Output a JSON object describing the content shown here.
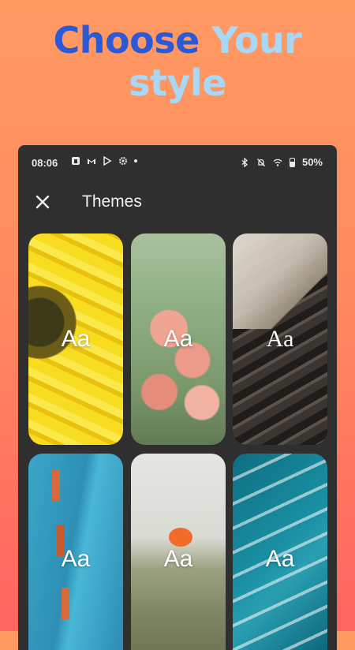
{
  "headline": {
    "word1": "Choose",
    "word2": "Your",
    "line2": "style"
  },
  "status_bar": {
    "time": "08:06",
    "battery": "50%"
  },
  "app_bar": {
    "title": "Themes"
  },
  "themes": [
    {
      "label": "Aa"
    },
    {
      "label": "Aa"
    },
    {
      "label": "Aa"
    },
    {
      "label": "Aa"
    },
    {
      "label": "Aa"
    },
    {
      "label": "Aa"
    }
  ],
  "colors": {
    "accent_blue": "#2c5ad7",
    "accent_light": "#a8d8f6",
    "panel_bg": "#2f2f2f"
  }
}
